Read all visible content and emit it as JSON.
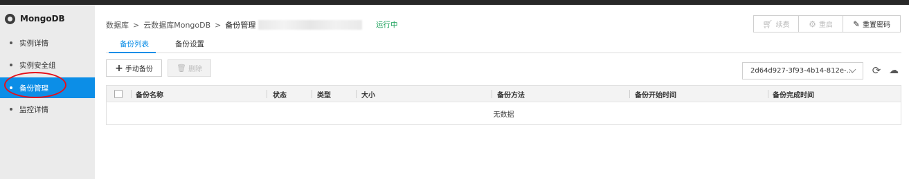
{
  "sidebar": {
    "brand": "MongoDB",
    "items": [
      {
        "label": "实例详情"
      },
      {
        "label": "实例安全组"
      },
      {
        "label": "备份管理"
      },
      {
        "label": "监控详情"
      }
    ]
  },
  "breadcrumb": {
    "items": [
      "数据库",
      "云数据库MongoDB",
      "备份管理"
    ],
    "separator": ">"
  },
  "status": "运行中",
  "header_buttons": {
    "renew": "续费",
    "restart": "重启",
    "reset_password": "重置密码"
  },
  "tabs": [
    "备份列表",
    "备份设置"
  ],
  "toolbar": {
    "manual_backup": "手动备份",
    "delete": "删除"
  },
  "instance_select": {
    "value": "2d64d927-3f93-4b14-812e-..."
  },
  "table": {
    "columns": [
      "备份名称",
      "状态",
      "类型",
      "大小",
      "备份方法",
      "备份开始时间",
      "备份完成时间"
    ],
    "empty_text": "无数据"
  },
  "colors": {
    "accent": "#0c8ee7",
    "status_running": "#18a058",
    "annotation": "#e5101a"
  }
}
